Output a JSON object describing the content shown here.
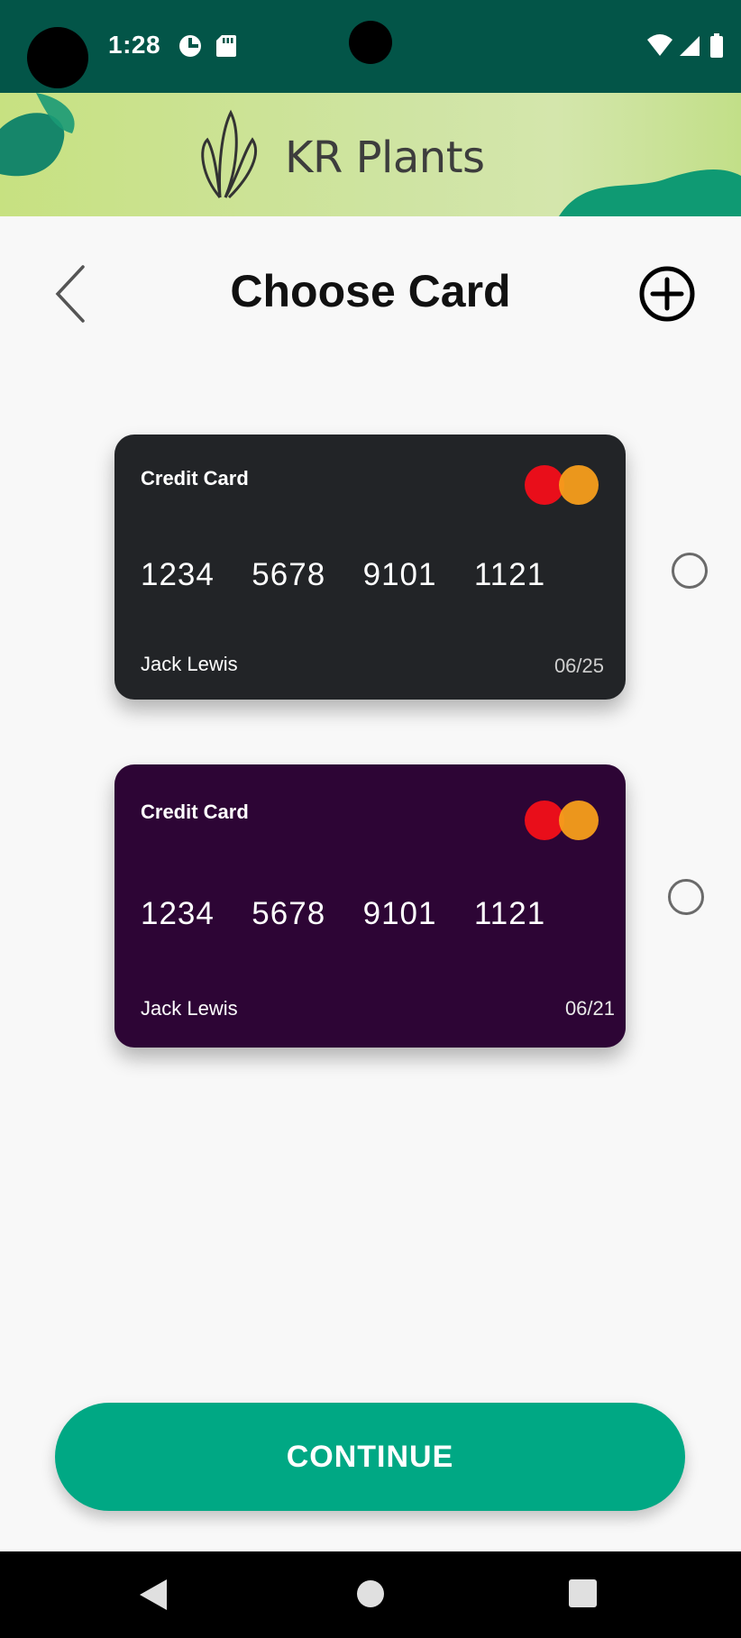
{
  "status_bar": {
    "time": "1:28",
    "icons": [
      "data-saver-icon",
      "sd-card-icon",
      "wifi-icon",
      "signal-icon",
      "battery-icon"
    ]
  },
  "banner": {
    "brand": "KR Plants",
    "logo_icon": "plant-hand-logo"
  },
  "header": {
    "title": "Choose Card",
    "back_icon": "chevron-left-icon",
    "add_icon": "plus-circle-icon"
  },
  "cards": [
    {
      "type_label": "Credit Card",
      "number": "1234  5678  9101  1121",
      "holder": "Jack Lewis",
      "expiry": "06/25",
      "color": "#222427",
      "brand_icon": "mastercard-icon",
      "selected": false
    },
    {
      "type_label": "Credit Card",
      "number": "1234  5678  9101  1121",
      "holder": "Jack Lewis",
      "expiry": "06/21",
      "color": "#2d0535",
      "brand_icon": "mastercard-icon",
      "selected": false
    }
  ],
  "footer": {
    "continue_label": "CONTINUE",
    "accent_color": "#00a884"
  },
  "nav_bar": {
    "icons": [
      "nav-back-icon",
      "nav-home-icon",
      "nav-recent-icon"
    ]
  }
}
